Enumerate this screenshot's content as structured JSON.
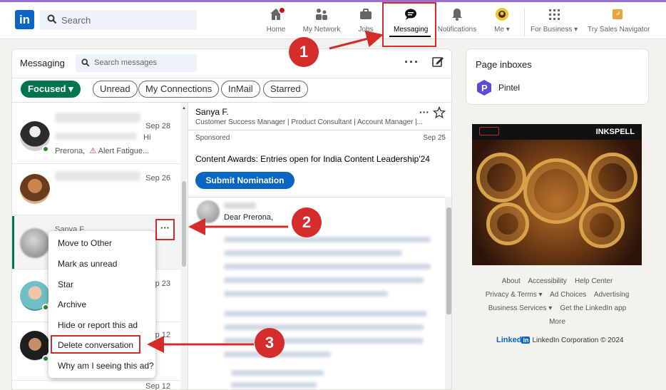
{
  "header": {
    "logo": "in",
    "search_placeholder": "Search",
    "nav": [
      {
        "label": "Home",
        "icon": "home-icon"
      },
      {
        "label": "My Network",
        "icon": "people-icon"
      },
      {
        "label": "Jobs",
        "icon": "briefcase-icon"
      },
      {
        "label": "Messaging",
        "icon": "chat-icon",
        "active": true
      },
      {
        "label": "Notifications",
        "icon": "bell-icon"
      },
      {
        "label": "Me ▾",
        "icon": "avatar-icon"
      },
      {
        "label": "For Business ▾",
        "icon": "grid-icon"
      },
      {
        "label": "Try Sales Navigator",
        "icon": "sales-navigator-icon"
      }
    ]
  },
  "messaging": {
    "title": "Messaging",
    "search_placeholder": "Search messages",
    "more": "···",
    "filters": [
      "Focused ▾",
      "Unread",
      "My Connections",
      "InMail",
      "Starred"
    ],
    "conversations": [
      {
        "date": "Sep 28",
        "snippet_partial": "Hi",
        "snippet": "Prerona,",
        "snippet2": "Alert Fatigue..."
      },
      {
        "date": "Sep 26"
      },
      {
        "name": "Sanya F.",
        "date": ""
      },
      {
        "date": "p 23"
      },
      {
        "date": "p 12"
      },
      {
        "date": "Sep 12"
      }
    ],
    "dots": "···",
    "context_menu": [
      "Move to Other",
      "Mark as unread",
      "Star",
      "Archive",
      "Hide or report this ad",
      "Delete conversation",
      "Why am I seeing this ad?"
    ]
  },
  "thread": {
    "name": "Sanya F.",
    "subtitle": "Customer Success Manager | Product Consultant | Account Manager |...",
    "more": "···",
    "sponsored": "Sponsored",
    "date": "Sep 25",
    "headline": "Content Awards: Entries open for India Content Leadership'24",
    "cta": "Submit Nomination",
    "greeting": "Dear Prerona,"
  },
  "right": {
    "inbox_title": "Page inboxes",
    "page_name": "Pintel",
    "ad_brand": "INKSPELL",
    "footer": [
      [
        "About",
        "Accessibility",
        "Help Center"
      ],
      [
        "Privacy & Terms ▾",
        "Ad Choices",
        "Advertising"
      ],
      [
        "Business Services ▾",
        "Get the LinkedIn app"
      ],
      [
        "More"
      ]
    ],
    "corp_brand": "Linked",
    "corp_in": "in",
    "corp_text": "LinkedIn Corporation © 2024"
  },
  "callouts": [
    "1",
    "2",
    "3"
  ],
  "colors": {
    "linkedin_blue": "#0a66c2",
    "focused_green": "#01754f",
    "callout_red": "#d42b2b",
    "notification_red": "#cc1016"
  }
}
